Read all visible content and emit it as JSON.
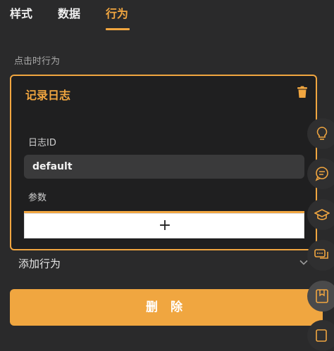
{
  "tabs": [
    "样式",
    "数据",
    "行为"
  ],
  "active_tab": "行为",
  "section": {
    "label": "点击时行为"
  },
  "behavior_card": {
    "title": "记录日志",
    "log_id_label": "日志ID",
    "log_id_value": "default",
    "params_label": "参数",
    "add_param_symbol": "+"
  },
  "add_behavior_label": "添加行为",
  "delete_label": "删 除",
  "side_toolbar": [
    "lightbulb-icon",
    "chat-bubble-icon",
    "graduation-cap-icon",
    "comments-icon",
    "bookmark-book-icon",
    "edit-note-icon"
  ],
  "colors": {
    "accent": "#f1a640",
    "background": "#2a2a2b",
    "card": "#1f1f20"
  }
}
